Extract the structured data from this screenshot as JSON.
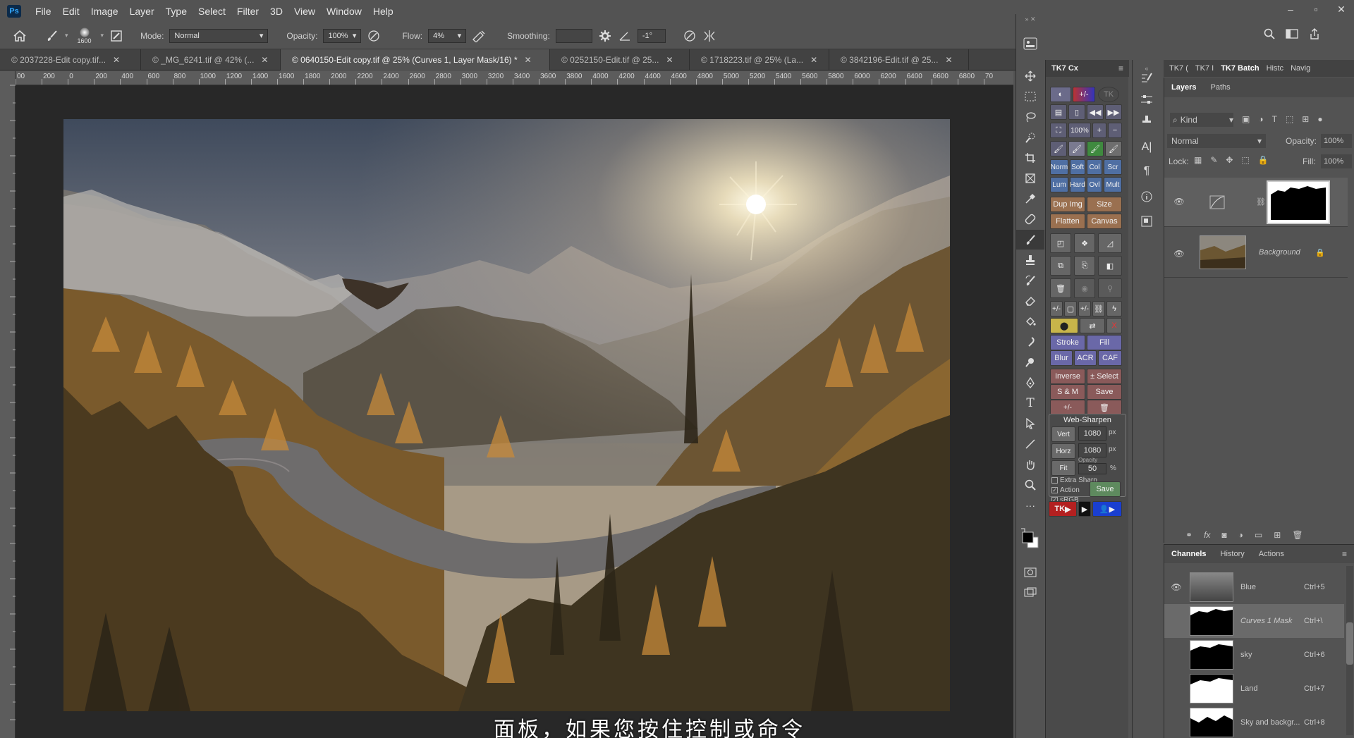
{
  "menubar": {
    "logo": "Ps",
    "items": [
      "File",
      "Edit",
      "Image",
      "Layer",
      "Type",
      "Select",
      "Filter",
      "3D",
      "View",
      "Window",
      "Help"
    ]
  },
  "options_bar": {
    "brush_size": "1600",
    "mode_label": "Mode:",
    "mode_value": "Normal",
    "opacity_label": "Opacity:",
    "opacity_value": "100%",
    "flow_label": "Flow:",
    "flow_value": "4%",
    "smoothing_label": "Smoothing:",
    "angle_value": "-1°"
  },
  "tabs": [
    {
      "label": "© 2037228-Edit copy.tif...",
      "active": false
    },
    {
      "label": "© _MG_6241.tif @ 42% (...",
      "active": false
    },
    {
      "label": "© 0640150-Edit copy.tif @ 25% (Curves 1, Layer Mask/16) *",
      "active": true
    },
    {
      "label": "© 0252150-Edit.tif @ 25...",
      "active": false
    },
    {
      "label": "© 1718223.tif @ 25% (La...",
      "active": false
    },
    {
      "label": "© 3842196-Edit.tif @ 25...",
      "active": false
    }
  ],
  "ruler_ticks": [
    "00",
    "200",
    "0",
    "200",
    "400",
    "600",
    "800",
    "1000",
    "1200",
    "1400",
    "1600",
    "1800",
    "2000",
    "2200",
    "2400",
    "2600",
    "2800",
    "3000",
    "3200",
    "3400",
    "3600",
    "3800",
    "4000",
    "4200",
    "4400",
    "4600",
    "4800",
    "5000",
    "5200",
    "5400",
    "5600",
    "5800",
    "6000",
    "6200",
    "6400",
    "6600",
    "6800",
    "70"
  ],
  "subtitle": "面板，如果您按住控制或命令",
  "tk7": {
    "title": "TK7 Cx",
    "zoom": "100%",
    "blend_row1": [
      "Norm",
      "Soft",
      "Col",
      "Scr"
    ],
    "blend_row2": [
      "Lum",
      "Hard",
      "Ovl",
      "Mult"
    ],
    "dup_img": "Dup Img",
    "size": "Size",
    "flatten": "Flatten",
    "canvas": "Canvas",
    "stroke": "Stroke",
    "fill": "Fill",
    "blur": "Blur",
    "acr": "ACR",
    "caf": "CAF",
    "inverse": "Inverse",
    "select": "± Select",
    "sm": "S & M",
    "save": "Save",
    "web_sharpen": "Web-Sharpen",
    "vert": "Vert",
    "vert_value": "1080",
    "horz": "Horz",
    "horz_value": "1080",
    "px": "px",
    "fit": "Fit",
    "opacity_label": "Opacity",
    "opacity_value": "50",
    "percent": "%",
    "extra_sharp": "Extra Sharp",
    "action": "Action",
    "srgb": "sRGB",
    "save2": "Save",
    "tk_label": "TK",
    "x_label": "X",
    "plusminus": "+/-"
  },
  "panel_tabs_top": [
    "TK7 (",
    "TK7 I",
    "TK7 Batch",
    "Histc",
    "Navig"
  ],
  "layers_panel": {
    "tabs": [
      "Layers",
      "Paths"
    ],
    "kind_label": "Kind",
    "blend_mode": "Normal",
    "opacity_label": "Opacity:",
    "opacity_value": "100%",
    "lock_label": "Lock:",
    "fill_label": "Fill:",
    "fill_value": "100%",
    "layers": [
      {
        "name": "",
        "type": "curves-adjustment"
      },
      {
        "name": "Background",
        "type": "image",
        "locked": true
      }
    ]
  },
  "channels_panel": {
    "tabs": [
      "Channels",
      "History",
      "Actions"
    ],
    "channels": [
      {
        "name": "Blue",
        "shortcut": "Ctrl+5",
        "visible": true
      },
      {
        "name": "Curves 1 Mask",
        "shortcut": "Ctrl+\\",
        "visible": false,
        "italic": true
      },
      {
        "name": "sky",
        "shortcut": "Ctrl+6",
        "visible": false
      },
      {
        "name": "Land",
        "shortcut": "Ctrl+7",
        "visible": false
      },
      {
        "name": "Sky and backgr...",
        "shortcut": "Ctrl+8",
        "visible": false
      }
    ]
  },
  "colors": {
    "ui_bg": "#535353",
    "canvas_bg": "#282828",
    "accent_blue": "#31a8ff",
    "tk_red": "#b32020"
  }
}
